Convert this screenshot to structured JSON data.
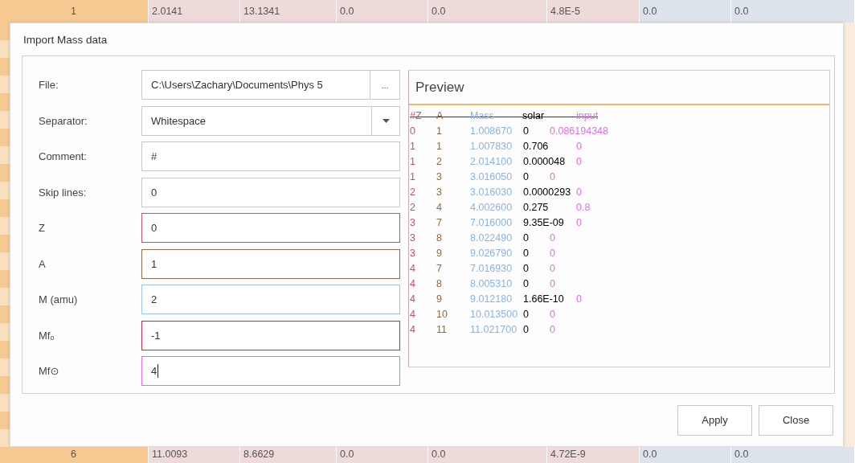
{
  "background_table": {
    "rows": [
      {
        "cells": [
          "1",
          "2.0141",
          "13.1341",
          "0.0",
          "0.0",
          "4.8E-5",
          "0.0",
          "0.0"
        ]
      },
      {
        "cells": [
          "6",
          "11.0093",
          "8.6629",
          "0.0",
          "0.0",
          "4.72E-9",
          "0.0",
          "0.0"
        ]
      }
    ]
  },
  "dialog": {
    "title": "Import Mass data",
    "fields": [
      {
        "label": "File:",
        "kind": "browse",
        "value": "C:\\Users\\Zachary\\Documents\\Phys 5",
        "button": "..."
      },
      {
        "label": "Separator:",
        "kind": "dropdown",
        "value": "Whitespace"
      },
      {
        "label": "Comment:",
        "kind": "text",
        "value": "#"
      },
      {
        "label": "Skip lines:",
        "kind": "text",
        "value": "0"
      },
      {
        "label": "Z",
        "kind": "text",
        "value": "0",
        "color": "#c0507a"
      },
      {
        "label": "A",
        "kind": "text",
        "value": "1",
        "color": "#8a6a4a"
      },
      {
        "label": "M (amu)",
        "kind": "text",
        "value": "2",
        "color": "#9cc4e8"
      },
      {
        "label": "Mfₒ",
        "kind": "text",
        "value": "-1",
        "color": "#b03050"
      },
      {
        "label": "Mf⊙",
        "kind": "text",
        "value": "4",
        "color": "#e070e0",
        "focused": true
      }
    ],
    "preview": {
      "title": "Preview",
      "header": [
        {
          "label": "#Z",
          "color": "#c0507a"
        },
        {
          "label": "A",
          "color": "#8a6a4a"
        },
        {
          "label": "Mass",
          "color": "#8ab4e0"
        },
        {
          "label": "solar",
          "color": "#000000"
        },
        {
          "label": "input",
          "color": "#e070e0"
        }
      ],
      "rows": [
        [
          "0",
          "1",
          "1.008670",
          "0",
          "0.086194348"
        ],
        [
          "1",
          "1",
          "1.007830",
          "0.706",
          "0"
        ],
        [
          "1",
          "2",
          "2.014100",
          "0.000048",
          "0"
        ],
        [
          "1",
          "3",
          "3.016050",
          "0",
          "0"
        ],
        [
          "2",
          "3",
          "3.016030",
          "0.0000293",
          "0"
        ],
        [
          "2",
          "4",
          "4.002600",
          "0.275",
          "0.8"
        ],
        [
          "3",
          "7",
          "7.016000",
          "9.35E-09",
          "0"
        ],
        [
          "3",
          "8",
          "8.022490",
          "0",
          "0"
        ],
        [
          "3",
          "9",
          "9.026790",
          "0",
          "0"
        ],
        [
          "4",
          "7",
          "7.016930",
          "0",
          "0"
        ],
        [
          "4",
          "8",
          "8.005310",
          "0",
          "0"
        ],
        [
          "4",
          "9",
          "9.012180",
          "1.66E-10",
          "0"
        ],
        [
          "4",
          "10",
          "10.013500",
          "0",
          "0"
        ],
        [
          "4",
          "11",
          "11.021700",
          "0",
          "0"
        ]
      ]
    },
    "buttons": [
      "Apply",
      "Close"
    ]
  }
}
